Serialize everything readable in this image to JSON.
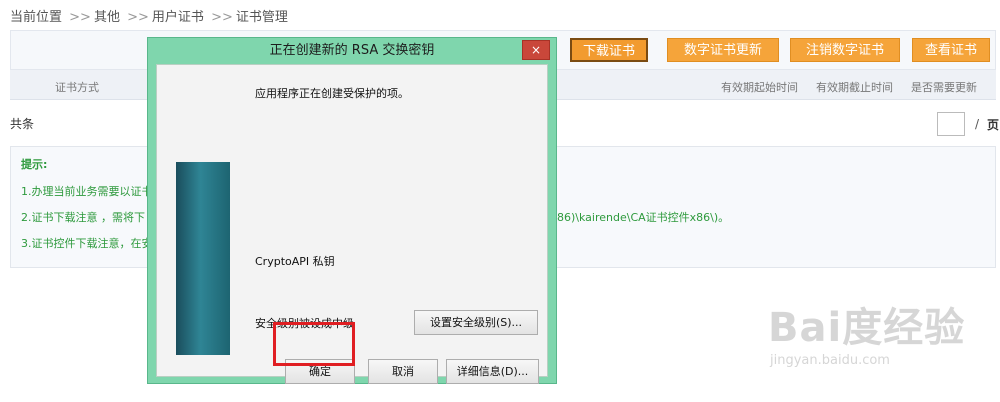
{
  "breadcrumb": {
    "items": [
      "当前位置",
      "其他",
      "用户证书",
      "证书管理"
    ],
    "separator": ">>"
  },
  "toolbar": {
    "buttons": [
      "下载证书",
      "数字证书更新",
      "注销数字证书",
      "查看证书"
    ],
    "accent_color": "#f5a43a"
  },
  "table": {
    "columns": [
      "证书方式",
      "有效期起始时间",
      "有效期截止时间",
      "是否需要更新"
    ]
  },
  "pager": {
    "count_label": "共条",
    "separator": "/",
    "page_label": "页"
  },
  "tips": {
    "title": "提示:",
    "lines": [
      "1.办理当前业务需要以证书",
      "2.证书下载注意 ，需将下",
      "3.证书控件下载注意，在安"
    ],
    "line2_tail": "86)\\kairende\\CA证书控件x86\\)。"
  },
  "dialog": {
    "title": "正在创建新的 RSA 交换密钥",
    "close_label": "×",
    "message": "应用程序正在创建受保护的项。",
    "key_name": "CryptoAPI 私钥",
    "security_level": "安全级别被设成中级",
    "set_level_button": "设置安全级别(S)...",
    "ok_button": "确定",
    "cancel_button": "取消",
    "details_button": "详细信息(D)..."
  },
  "watermark": {
    "logo": "Bai度经验",
    "url": "jingyan.baidu.com"
  }
}
